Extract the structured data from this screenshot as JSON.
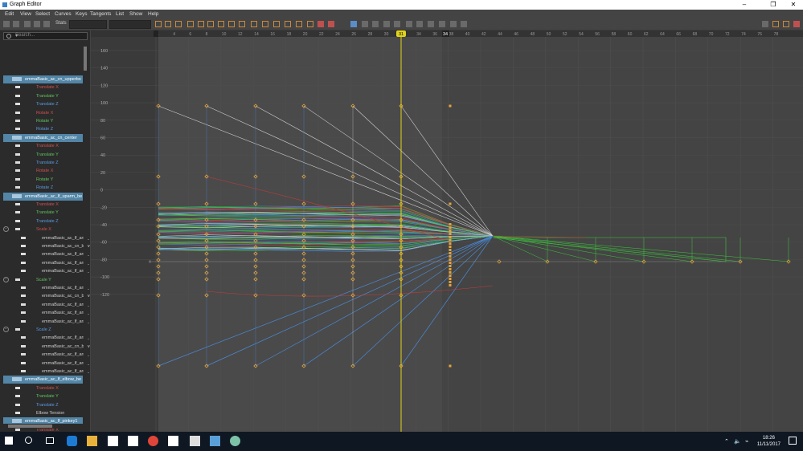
{
  "window": {
    "title": "Graph Editor",
    "minimize": "–",
    "maximize": "❐",
    "close": "✕"
  },
  "menu": [
    "Edit",
    "View",
    "Select",
    "Curves",
    "Keys",
    "Tangents",
    "List",
    "Show",
    "Help"
  ],
  "toolbar": {
    "stats_label": "Stats"
  },
  "outliner": {
    "search_placeholder": "Search...",
    "rows": [
      {
        "type": "node",
        "label": "emmaBasic_ac_cn_upperbo"
      },
      {
        "type": "attr",
        "label": "Translate X",
        "color": "#d05050"
      },
      {
        "type": "attr",
        "label": "Translate Y",
        "color": "#5fc35f"
      },
      {
        "type": "attr",
        "label": "Translate Z",
        "color": "#5a9ae0"
      },
      {
        "type": "attr",
        "label": "Rotate X",
        "color": "#d05050"
      },
      {
        "type": "attr",
        "label": "Rotate Y",
        "color": "#5fc35f"
      },
      {
        "type": "attr",
        "label": "Rotate Z",
        "color": "#5a9ae0"
      },
      {
        "type": "node",
        "label": "emmaBasic_ac_cn_center"
      },
      {
        "type": "attr",
        "label": "Translate X",
        "color": "#d05050"
      },
      {
        "type": "attr",
        "label": "Translate Y",
        "color": "#5fc35f"
      },
      {
        "type": "attr",
        "label": "Translate Z",
        "color": "#5a9ae0"
      },
      {
        "type": "attr",
        "label": "Rotate X",
        "color": "#d05050"
      },
      {
        "type": "attr",
        "label": "Rotate Y",
        "color": "#5fc35f"
      },
      {
        "type": "attr",
        "label": "Rotate Z",
        "color": "#5a9ae0"
      },
      {
        "type": "node",
        "label": "emmaBasic_ac_lf_uparm_be"
      },
      {
        "type": "attr",
        "label": "Translate X",
        "color": "#d05050"
      },
      {
        "type": "attr",
        "label": "Translate Y",
        "color": "#5fc35f"
      },
      {
        "type": "attr",
        "label": "Translate Z",
        "color": "#5a9ae0"
      },
      {
        "type": "group",
        "label": "Scale X",
        "color": "#d05050"
      },
      {
        "type": "sub",
        "label": "emmaBasic_ac_lf_arm_"
      },
      {
        "type": "sub",
        "label": "emmaBasic_ac_cn_bdw"
      },
      {
        "type": "sub",
        "label": "emmaBasic_ac_lf_arm_"
      },
      {
        "type": "sub",
        "label": "emmaBasic_ac_lf_arm_"
      },
      {
        "type": "sub",
        "label": "emmaBasic_ac_lf_arm_"
      },
      {
        "type": "group",
        "label": "Scale Y",
        "color": "#5fc35f"
      },
      {
        "type": "sub",
        "label": "emmaBasic_ac_lf_arm_"
      },
      {
        "type": "sub",
        "label": "emmaBasic_ac_cn_bdw"
      },
      {
        "type": "sub",
        "label": "emmaBasic_ac_lf_arm_"
      },
      {
        "type": "sub",
        "label": "emmaBasic_ac_lf_arm_"
      },
      {
        "type": "sub",
        "label": "emmaBasic_ac_lf_arm_"
      },
      {
        "type": "group",
        "label": "Scale Z",
        "color": "#5a9ae0"
      },
      {
        "type": "sub",
        "label": "emmaBasic_ac_lf_arm_"
      },
      {
        "type": "sub",
        "label": "emmaBasic_ac_cn_bdw"
      },
      {
        "type": "sub",
        "label": "emmaBasic_ac_lf_arm_"
      },
      {
        "type": "sub",
        "label": "emmaBasic_ac_lf_arm_"
      },
      {
        "type": "sub",
        "label": "emmaBasic_ac_lf_arm_"
      },
      {
        "type": "node",
        "label": "emmaBasic_ac_lf_elbow_be"
      },
      {
        "type": "attr",
        "label": "Translate X",
        "color": "#d05050"
      },
      {
        "type": "attr",
        "label": "Translate Y",
        "color": "#5fc35f"
      },
      {
        "type": "attr",
        "label": "Translate Z",
        "color": "#5a9ae0"
      },
      {
        "type": "attr",
        "label": "Elbow Tension",
        "color": "#cccccc"
      },
      {
        "type": "node",
        "label": "emmaBasic_ac_lf_pinkey1"
      },
      {
        "type": "attr",
        "label": "Translate X",
        "color": "#d05050"
      },
      {
        "type": "attr",
        "label": "Translate Y",
        "color": "#5fc35f"
      },
      {
        "type": "attr",
        "label": "Translate Z",
        "color": "#5a9ae0"
      }
    ]
  },
  "graph": {
    "frame_ticks": [
      [
        "1"
      ],
      [
        "4"
      ],
      [
        "6"
      ],
      [
        "8"
      ],
      [
        "10"
      ],
      [
        "12"
      ],
      [
        "14"
      ],
      [
        "16"
      ],
      [
        "18"
      ],
      [
        "20"
      ],
      [
        "22"
      ],
      [
        "24"
      ],
      [
        "26"
      ],
      [
        "28"
      ],
      [
        "30"
      ],
      [
        "32"
      ],
      [
        "34"
      ],
      [
        "36"
      ],
      [
        "38"
      ],
      [
        "40"
      ],
      [
        "42"
      ],
      [
        "44"
      ],
      [
        "46"
      ],
      [
        "48"
      ],
      [
        "50"
      ],
      [
        "52"
      ],
      [
        "54"
      ],
      [
        "56"
      ],
      [
        "58"
      ],
      [
        "60"
      ],
      [
        "62"
      ],
      [
        "64"
      ],
      [
        "66"
      ],
      [
        "68"
      ],
      [
        "70"
      ],
      [
        "72"
      ],
      [
        "74"
      ],
      [
        "76"
      ],
      [
        "78"
      ]
    ],
    "value_ticks": [
      "160",
      "140",
      "120",
      "100",
      "80",
      "60",
      "40",
      "20",
      "0",
      "-20",
      "-40",
      "-60",
      "-80",
      "-100",
      "-120"
    ],
    "current_frame": "31",
    "end_frame": "34"
  },
  "taskbar": {
    "time": "18:26",
    "date": "11/11/2017"
  },
  "colors": {
    "key": "#e6a43a",
    "time_cursor": "#e2d21a",
    "curve_red": "#c83a3a",
    "curve_green": "#3ac83a",
    "curve_blue": "#4a8ad8",
    "curve_white": "#cfcfcf"
  }
}
